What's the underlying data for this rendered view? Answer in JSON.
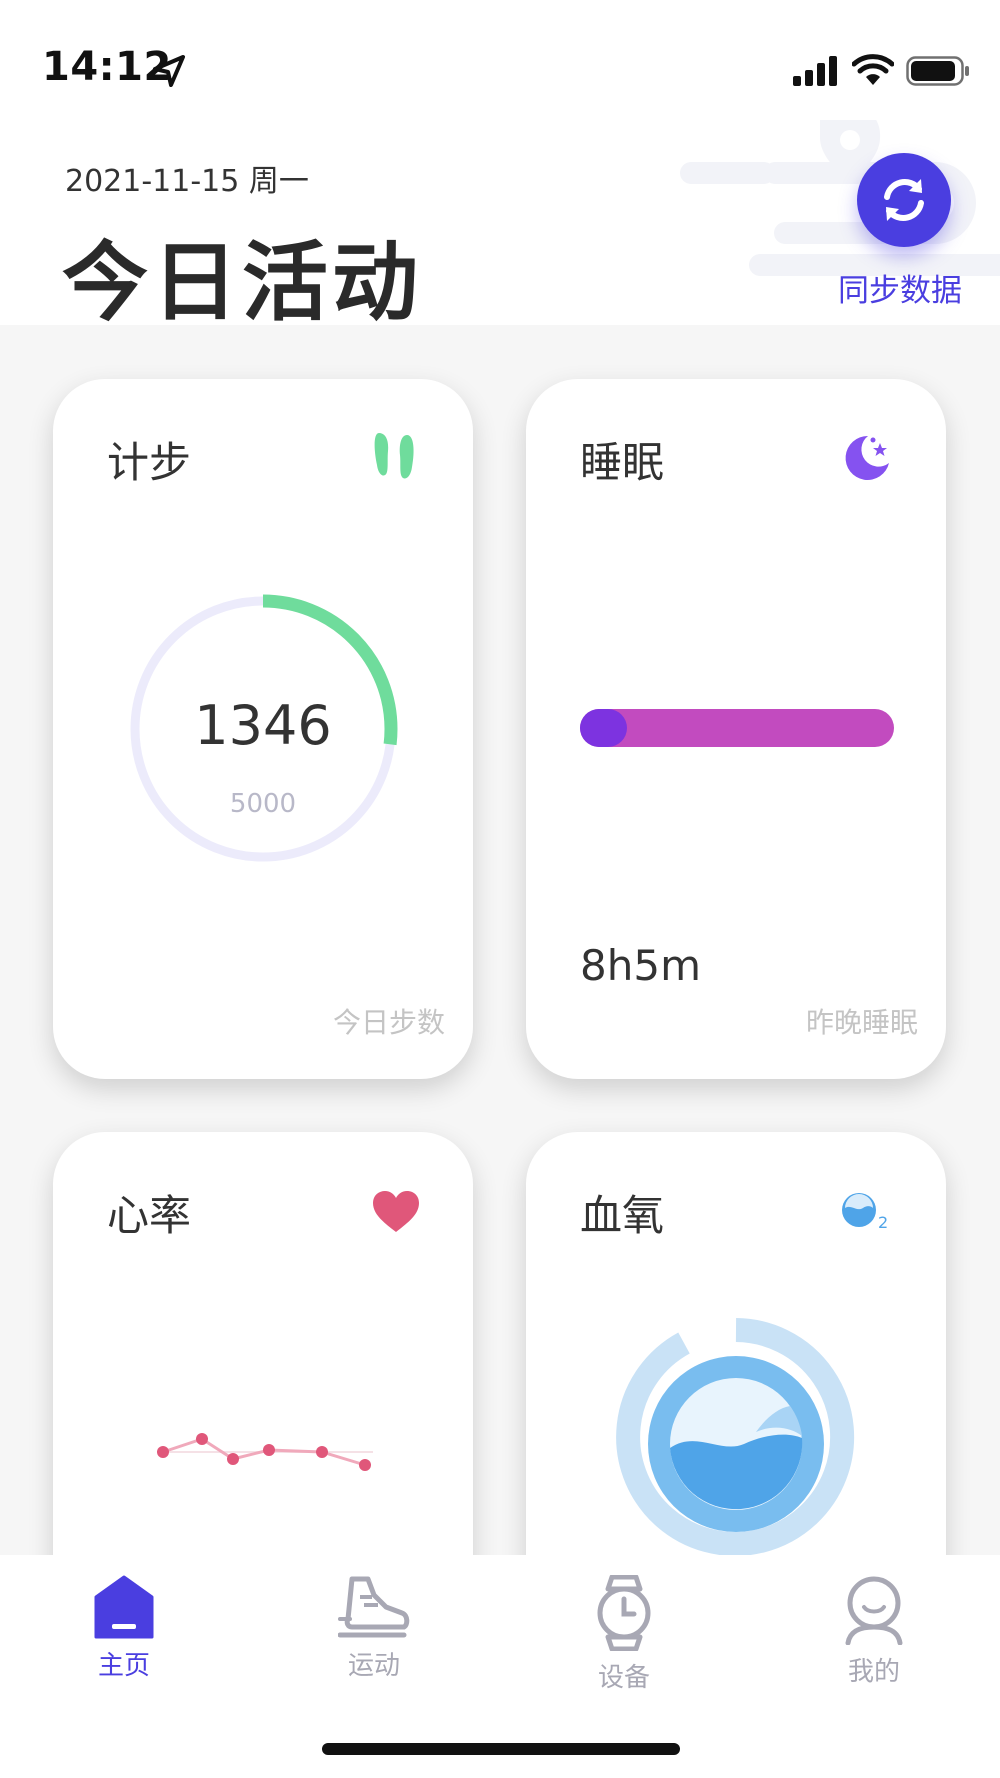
{
  "status_bar": {
    "time": "14:12"
  },
  "header": {
    "date": "2021-11-15 周一",
    "title": "今日活动",
    "sync_label": "同步数据"
  },
  "cards": {
    "steps": {
      "title": "计步",
      "value": "1346",
      "goal": "5000",
      "progress": 0.269,
      "footer": "今日步数",
      "icon": "footprints-icon"
    },
    "sleep": {
      "title": "睡眠",
      "duration": "8h5m",
      "deep_fraction": 0.15,
      "footer": "昨晚睡眠",
      "icon": "moon-icon"
    },
    "heart_rate": {
      "title": "心率",
      "icon": "heart-icon"
    },
    "blood_oxygen": {
      "title": "血氧",
      "icon": "o2-icon"
    }
  },
  "tabs": [
    {
      "label": "主页",
      "icon": "home-icon",
      "active": true
    },
    {
      "label": "运动",
      "icon": "shoe-icon",
      "active": false
    },
    {
      "label": "设备",
      "icon": "watch-icon",
      "active": false
    },
    {
      "label": "我的",
      "icon": "profile-icon",
      "active": false
    }
  ],
  "colors": {
    "accent": "#4a3ee0",
    "steps_ring": "#6fdc9c",
    "ring_track": "#ecebfb",
    "sleep_bar": "#c24bbf",
    "sleep_deep": "#7d33e0",
    "heart": "#e0577a",
    "spo2": "#4fa4e8"
  }
}
